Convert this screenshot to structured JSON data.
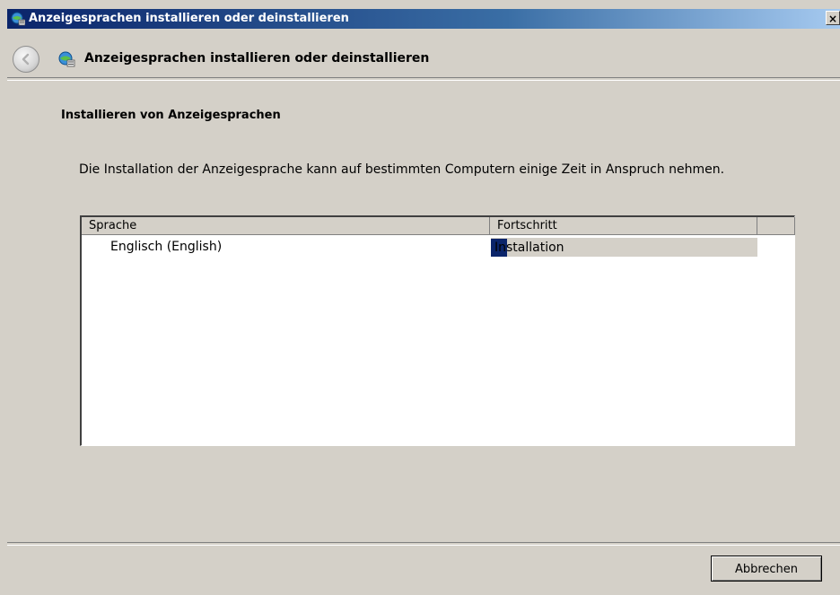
{
  "window": {
    "title": "Anzeigesprachen installieren oder deinstallieren",
    "close_label": "×"
  },
  "nav": {
    "back_icon": "back-arrow-icon",
    "page_icon": "globe-language-icon",
    "title": "Anzeigesprachen installieren oder deinstallieren"
  },
  "main": {
    "heading": "Installieren von Anzeigesprachen",
    "description": "Die Installation der Anzeigesprache kann auf bestimmten Computern einige Zeit in Anspruch nehmen."
  },
  "table": {
    "columns": [
      "Sprache",
      "Fortschritt"
    ],
    "rows": [
      {
        "language": "Englisch (English)",
        "status": "Installation",
        "progress_fraction": 0.06
      }
    ]
  },
  "footer": {
    "cancel_label": "Abbrechen"
  },
  "colors": {
    "chrome": "#d4d0c8",
    "title_bar": "#0a246a",
    "progress": "#0a246a"
  }
}
